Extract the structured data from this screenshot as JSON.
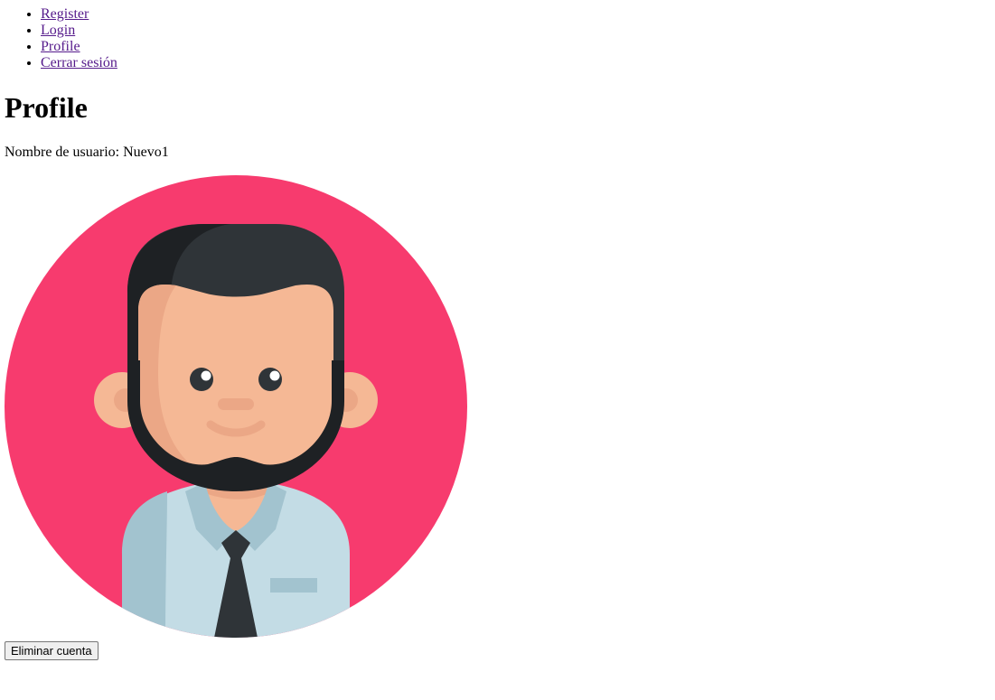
{
  "nav": {
    "items": [
      {
        "label": "Register"
      },
      {
        "label": "Login"
      },
      {
        "label": "Profile"
      },
      {
        "label": "Cerrar sesión"
      }
    ],
    "link_color": "#551a8b"
  },
  "profile": {
    "title": "Profile",
    "username_label": "Nombre de usuario:",
    "username_value": "Nuevo1",
    "avatar": {
      "icon": "man-with-beard-and-tie-avatar",
      "background_color": "#f73b6e",
      "skin_color": "#f5b895",
      "hair_color": "#2f3438",
      "shirt_color": "#c3dce5",
      "tie_color": "#2f3438"
    }
  },
  "actions": {
    "delete_label": "Eliminar cuenta"
  }
}
